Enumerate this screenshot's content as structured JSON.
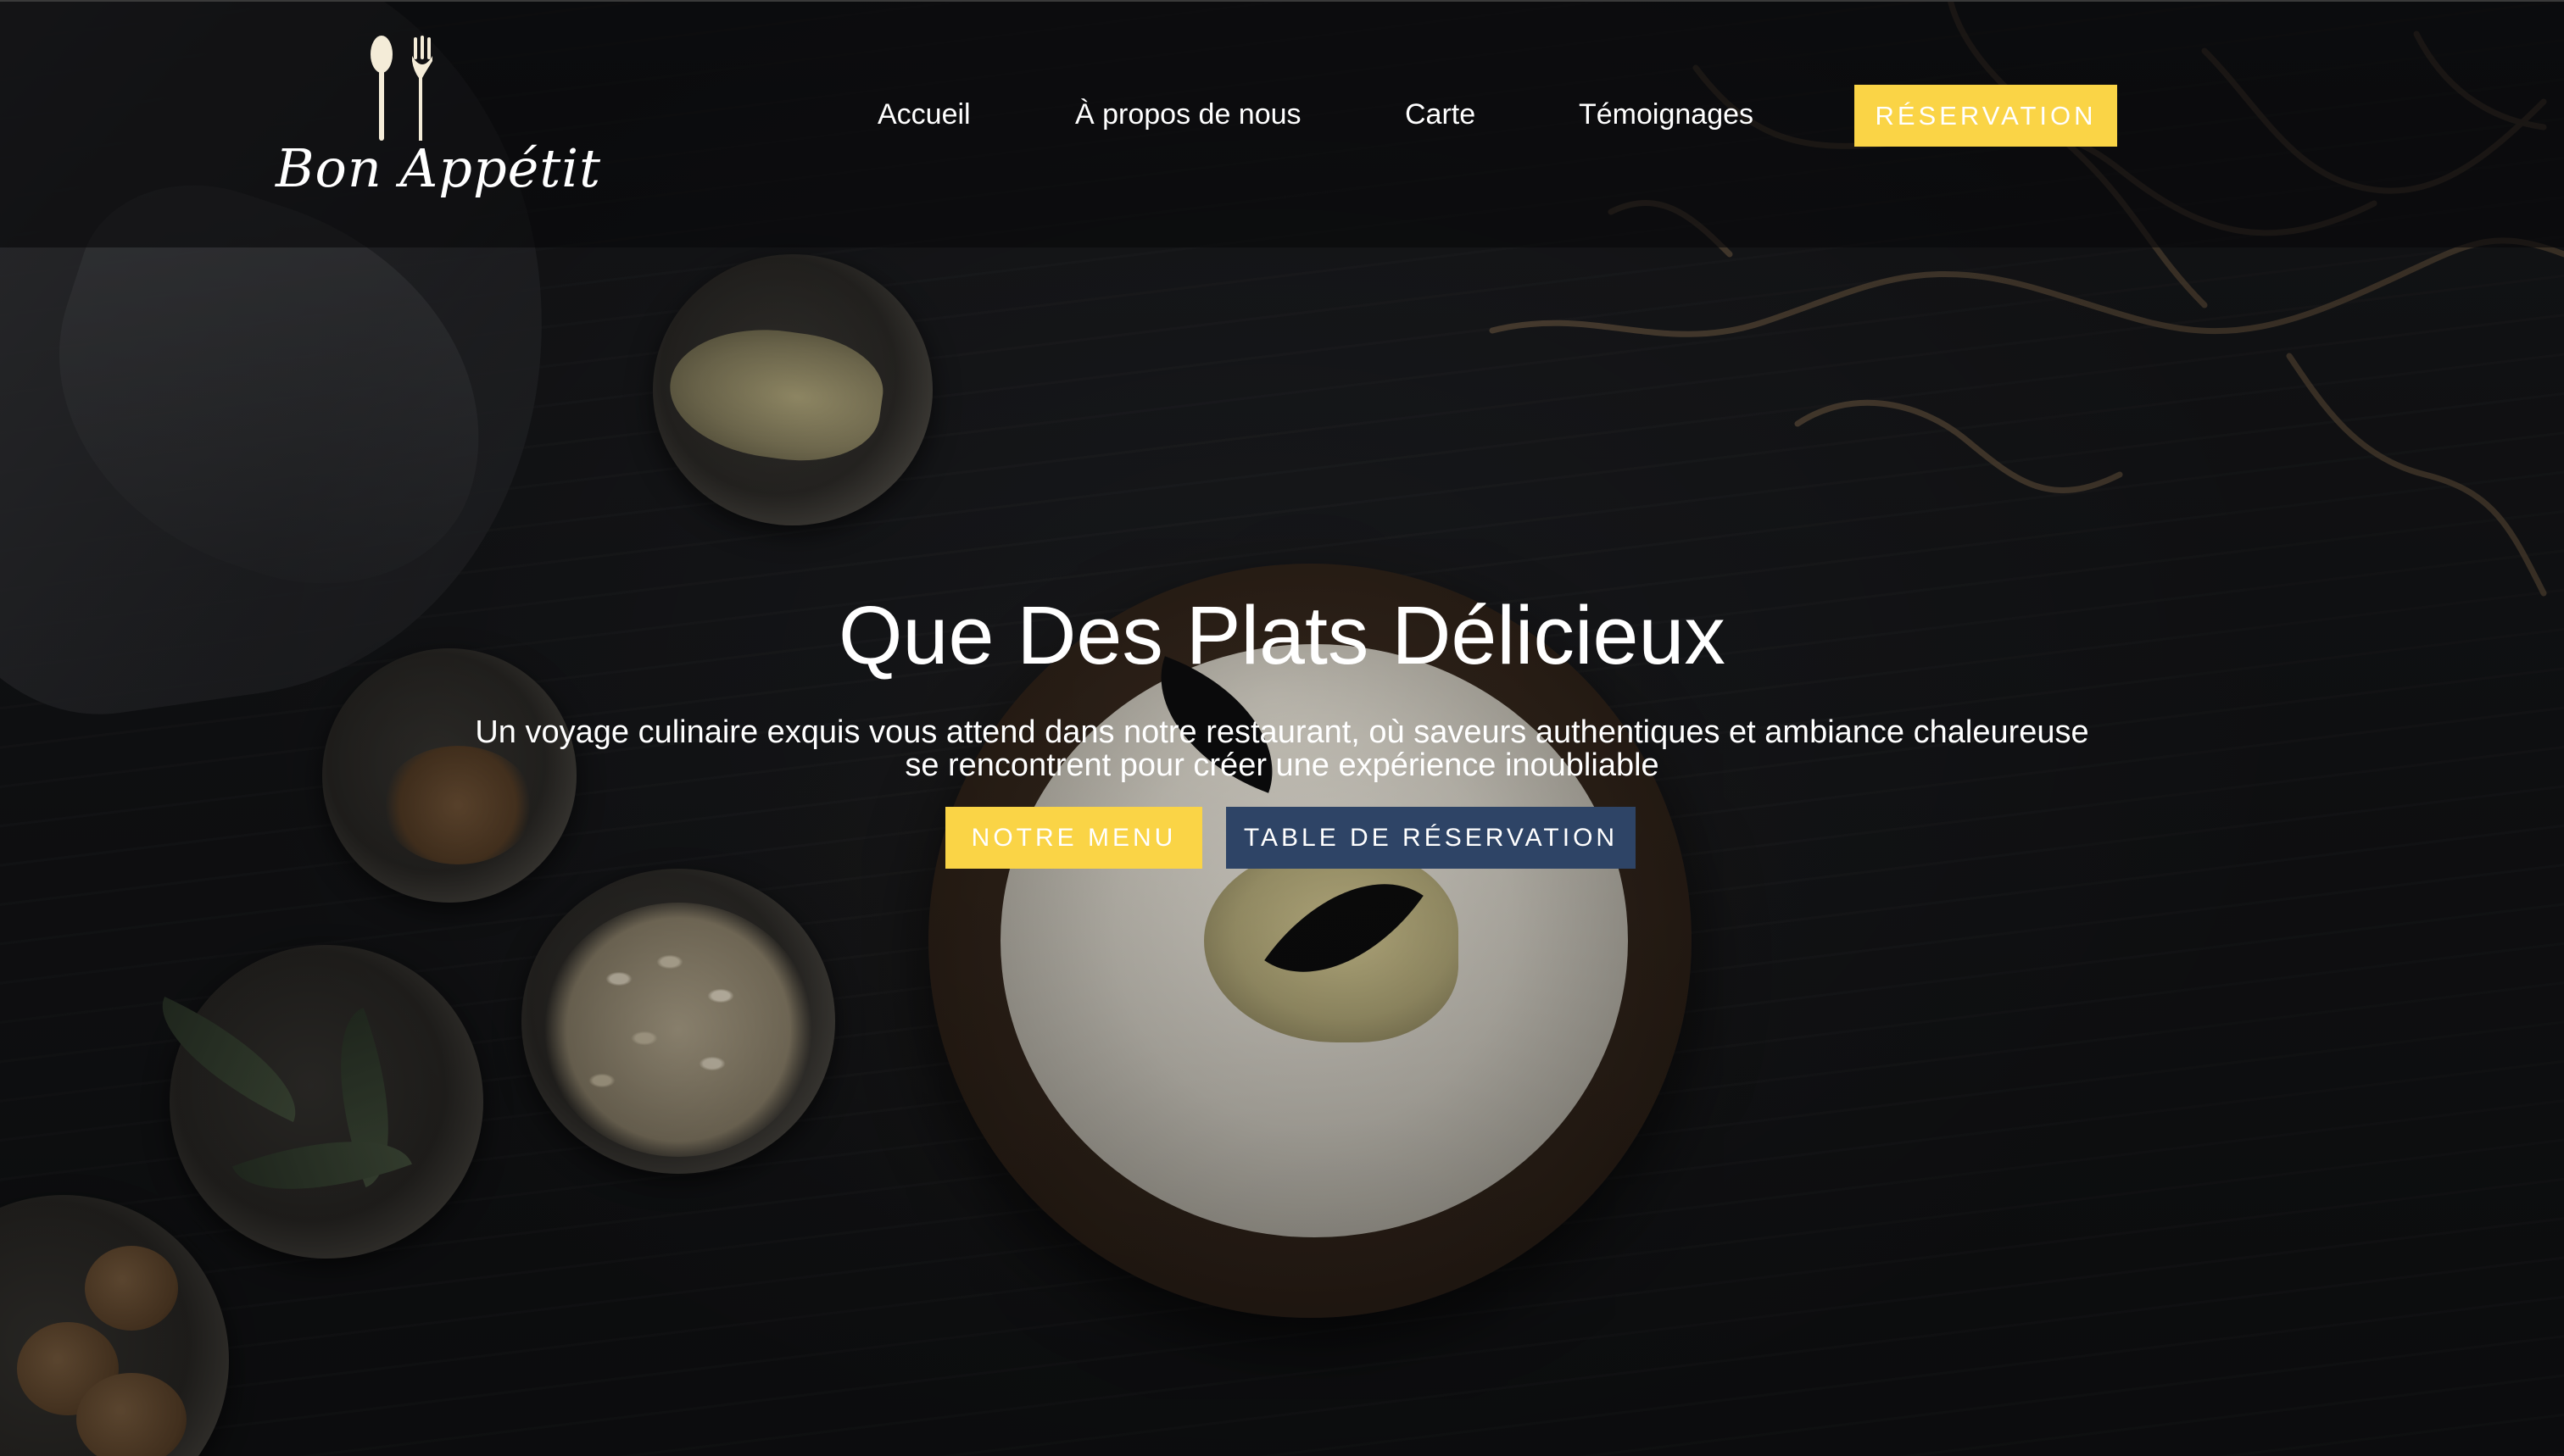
{
  "brand": {
    "name": "Bon Appétit",
    "accent_color": "#fad446",
    "secondary_button_color": "#2e4466"
  },
  "nav": {
    "items": [
      {
        "label": "Accueil"
      },
      {
        "label": "À propos de nous"
      },
      {
        "label": "Carte"
      },
      {
        "label": "Témoignages"
      }
    ],
    "cta_label": "RÉSERVATION"
  },
  "hero": {
    "title": "Que Des Plats Délicieux",
    "subtitle_line1": "Un voyage culinaire exquis vous attend dans notre restaurant, où saveurs authentiques et ambiance chaleureuse",
    "subtitle_line2": "se rencontrent pour créer une expérience inoubliable",
    "primary_button": "NOTRE MENU",
    "secondary_button": "TABLE DE RÉSERVATION"
  },
  "icons": {
    "logo": "spoon-fork-icon"
  }
}
